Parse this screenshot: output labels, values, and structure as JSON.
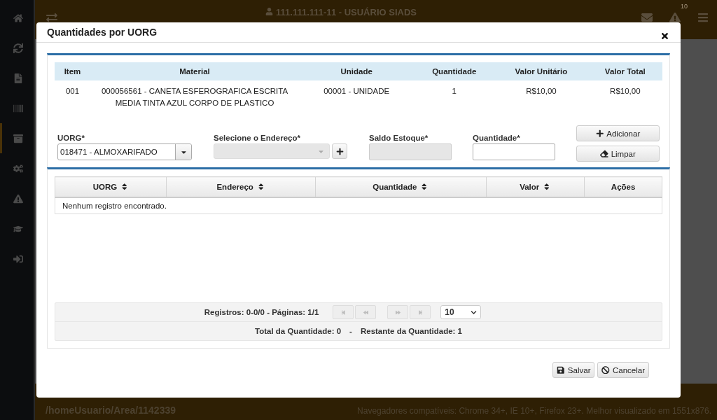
{
  "topbar": {
    "user": "111.111.111-11 - USUÁRIO SIADS",
    "alert_count": "10"
  },
  "sidebar": {
    "items": [
      {
        "selected": false
      },
      {
        "selected": false
      },
      {
        "selected": false
      },
      {
        "selected": false
      },
      {
        "selected": true
      },
      {
        "selected": false
      },
      {
        "selected": false
      },
      {
        "selected": false
      },
      {
        "selected": false
      }
    ]
  },
  "footer": {
    "path": "/homeUsuario/Area/1142339",
    "note": "Navegadores compatíveis: Chrome 34+, IE 10+, Firefox 23+. Melhor visualizado em 1551x876."
  },
  "modal": {
    "title": "Quantidades por UORG",
    "items_table": {
      "columns": [
        "Item",
        "Material",
        "Unidade",
        "Quantidade",
        "Valor Unitário",
        "Valor Total"
      ],
      "rows": [
        {
          "cells": [
            "001",
            "000056561 - CANETA ESFEROGRAFICA ESCRITA MEDIA TINTA AZUL CORPO DE PLASTICO",
            "00001 - UNIDADE",
            "1",
            "R$10,00",
            "R$10,00"
          ]
        }
      ]
    },
    "form": {
      "uorg": {
        "label": "UORG*",
        "value": "018471 - ALMOXARIFADO"
      },
      "endereco": {
        "label": "Selecione o Endereço*",
        "disabled": true
      },
      "saldo": {
        "label": "Saldo Estoque*",
        "disabled": true
      },
      "quantidade": {
        "label": "Quantidade*",
        "disabled": false
      },
      "actions": [
        {
          "kind": "add",
          "label": "Adicionar"
        },
        {
          "kind": "clear",
          "label": "Limpar"
        }
      ]
    },
    "results_table": {
      "columns": [
        {
          "label": "UORG",
          "sortable": true
        },
        {
          "label": "Endereço",
          "sortable": true
        },
        {
          "label": "Quantidade",
          "sortable": true
        },
        {
          "label": "Valor",
          "sortable": true
        },
        {
          "label": "Ações",
          "sortable": false
        }
      ],
      "empty_message": "Nenhum registro encontrado."
    },
    "paginator": {
      "summary": "Registros: 0-0/0 - Páginas: 1/1",
      "page_size": "10",
      "buttons": [
        {
          "kind": "first",
          "disabled": true
        },
        {
          "kind": "prev",
          "disabled": true
        },
        {
          "kind": "next",
          "disabled": true
        },
        {
          "kind": "last",
          "disabled": true
        }
      ]
    },
    "totals": {
      "total": "Total da Quantidade: 0",
      "separator": "-",
      "remaining": "Restante da Quantidade: 1"
    },
    "buttons": [
      {
        "kind": "save",
        "label": "Salvar"
      },
      {
        "kind": "cancel",
        "label": "Cancelar"
      }
    ]
  }
}
